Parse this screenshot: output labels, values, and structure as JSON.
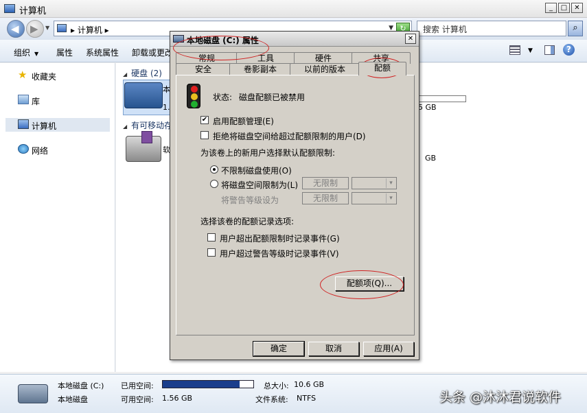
{
  "window": {
    "title": "计算机"
  },
  "address": {
    "crumb": "计算机",
    "search_placeholder": "搜索 计算机"
  },
  "toolbar": {
    "organize": "组织",
    "properties": "属性",
    "system_properties": "系统属性",
    "uninstall": "卸载或更改"
  },
  "nav": {
    "favorites": "收藏夹",
    "libraries": "库",
    "computer": "计算机",
    "network": "网络"
  },
  "content": {
    "hdd_group": "硬盘 (2)",
    "removable_group": "有可移动存",
    "drive_name_partial": "本",
    "drive_size_partial": "1.",
    "drive_right_text": "5 GB",
    "removable_name_partial": "软",
    "removable_right_text": "GB"
  },
  "details": {
    "name": "本地磁盘 (C:)",
    "type": "本地磁盘",
    "used_label": "已用空间:",
    "free_label": "可用空间:",
    "free_value": "1.56 GB",
    "total_label": "总大小:",
    "total_value": "10.6 GB",
    "fs_label": "文件系统:",
    "fs_value": "NTFS",
    "used_fraction": 0.85
  },
  "dialog": {
    "title": "本地磁盘 (C:) 属性",
    "tabs_row1": [
      "常规",
      "工具",
      "硬件",
      "共享"
    ],
    "tabs_row2": [
      "安全",
      "卷影副本",
      "以前的版本",
      "配额"
    ],
    "active_tab": "配额",
    "status_label": "状态:",
    "status_value": "磁盘配额已被禁用",
    "enable_quota": "启用配额管理(E)",
    "deny_space": "拒绝将磁盘空间给超过配额限制的用户(D)",
    "default_limit_heading": "为该卷上的新用户选择默认配额限制:",
    "no_limit": "不限制磁盘使用(O)",
    "limit_to": "将磁盘空间限制为(L)",
    "warning_level": "将警告等级设为",
    "unlimited_1": "无限制",
    "unlimited_2": "无限制",
    "logging_heading": "选择该卷的配额记录选项:",
    "log_exceed_limit": "用户超出配额限制时记录事件(G)",
    "log_exceed_warning": "用户超过警告等级时记录事件(V)",
    "quota_entries_button": "配额项(Q)...",
    "ok": "确定",
    "cancel": "取消",
    "apply": "应用(A)"
  },
  "watermark": "头条 @沐沐君说软件",
  "colors": {
    "annotation": "#d02020",
    "used_bar": "#1a3e8c"
  }
}
